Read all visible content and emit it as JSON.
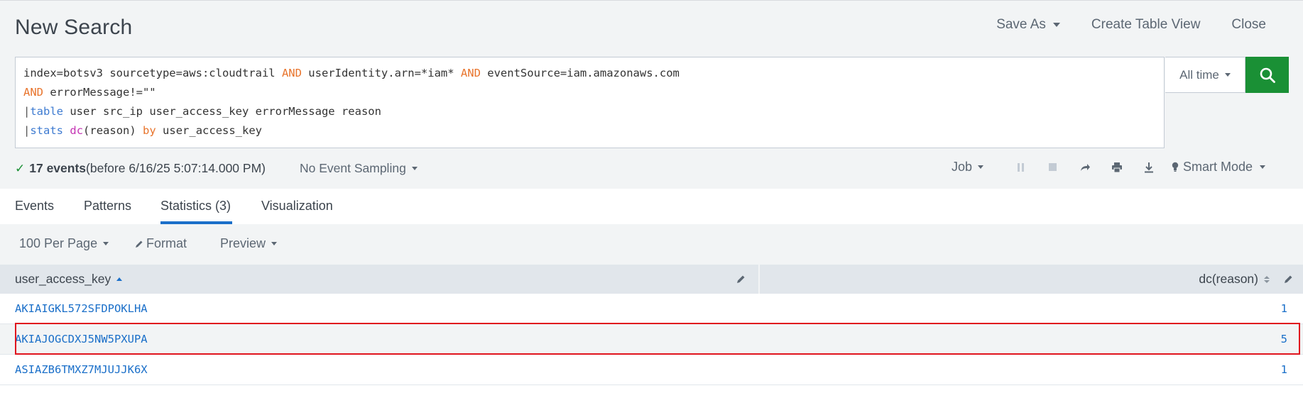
{
  "header": {
    "title": "New Search",
    "save_as": "Save As",
    "create_table_view": "Create Table View",
    "close": "Close"
  },
  "search": {
    "line1_a": "index=botsv3 sourcetype=aws:cloudtrail ",
    "line1_and1": "AND",
    "line1_b": " userIdentity.arn=*iam* ",
    "line1_and2": "AND",
    "line1_c": " eventSource=iam.amazonaws.com",
    "line2_and": "AND",
    "line2_b": " errorMessage!=\"\"",
    "line3_pipe": "|",
    "line3_cmd": "table",
    "line3_b": " user src_ip user_access_key errorMessage reason",
    "line4_pipe": "|",
    "line4_cmd": "stats",
    "line4_sp": " ",
    "line4_fn": "dc",
    "line4_b": "(reason) ",
    "line4_by": "by",
    "line4_c": " user_access_key",
    "time_range": "All time"
  },
  "status": {
    "count": "17 events",
    "before": " (before 6/16/25 5:07:14.000 PM)",
    "sampling": "No Event Sampling"
  },
  "jobbar": {
    "job": "Job",
    "mode": "Smart Mode"
  },
  "tabs": [
    {
      "label": "Events"
    },
    {
      "label": "Patterns"
    },
    {
      "label": "Statistics (3)"
    },
    {
      "label": "Visualization"
    }
  ],
  "toolbar": {
    "per_page": "100 Per Page",
    "format": "Format",
    "preview": "Preview"
  },
  "table": {
    "columns": [
      "user_access_key",
      "dc(reason)"
    ],
    "rows": [
      {
        "key": "AKIAIGKL572SFDPOKLHA",
        "value": "1"
      },
      {
        "key": "AKIAJOGCDXJ5NW5PXUPA",
        "value": "5"
      },
      {
        "key": "ASIAZB6TMXZ7MJUJJK6X",
        "value": "1"
      }
    ]
  },
  "colors": {
    "accent": "#1a6fc9",
    "search_button": "#1a9035",
    "highlight": "#e0141e"
  }
}
